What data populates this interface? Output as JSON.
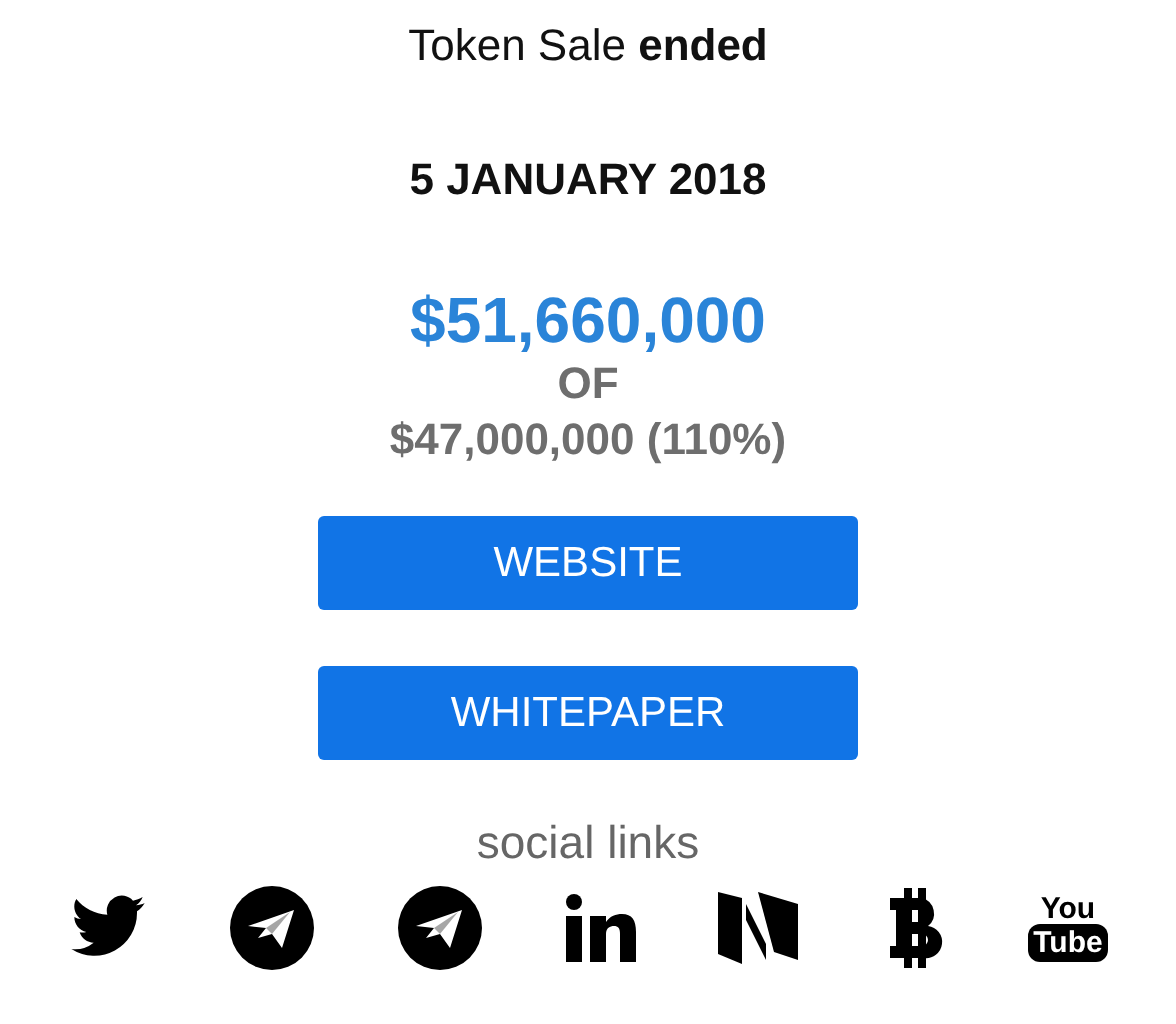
{
  "heading": "Token Sale **ended**",
  "date": "5 JANUARY 2018",
  "raised": "$51,660,000",
  "of": "OF",
  "goal": "$47,000,000 (110%)",
  "buttons": [
    "WEBSITE",
    "WHITEPAPER"
  ],
  "social_title": "social links",
  "social": [
    {
      "kind": "twitter"
    },
    {
      "kind": "telegram"
    },
    {
      "kind": "telegram"
    },
    {
      "kind": "linkedin"
    },
    {
      "kind": "medium"
    },
    {
      "kind": "bitcoin"
    },
    {
      "kind": "youtube",
      "text": [
        "You",
        "Tube"
      ]
    }
  ]
}
